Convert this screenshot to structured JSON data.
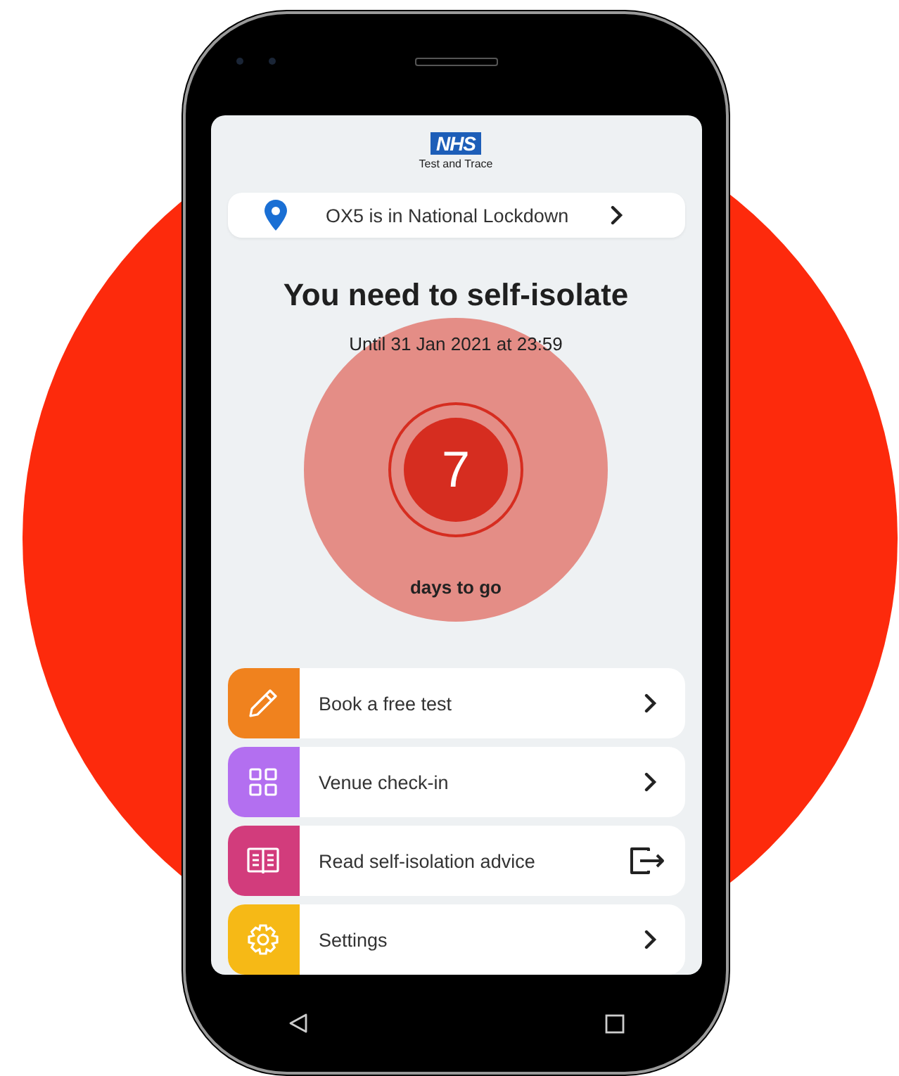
{
  "header": {
    "logo": "NHS",
    "subtitle": "Test and Trace"
  },
  "location": {
    "text": "OX5 is in National Lockdown"
  },
  "status": {
    "title": "You need to self-isolate",
    "until": "Until 31 Jan 2021 at 23:59"
  },
  "countdown": {
    "days": "7",
    "label": "days to go"
  },
  "menu": [
    {
      "label": "Book a free test",
      "kind": "chevron",
      "color": "#f0821e"
    },
    {
      "label": "Venue check-in",
      "kind": "chevron",
      "color": "#b36ff0"
    },
    {
      "label": "Read self-isolation advice",
      "kind": "external",
      "color": "#d23c7c"
    },
    {
      "label": "Settings",
      "kind": "chevron",
      "color": "#f6b916"
    }
  ]
}
